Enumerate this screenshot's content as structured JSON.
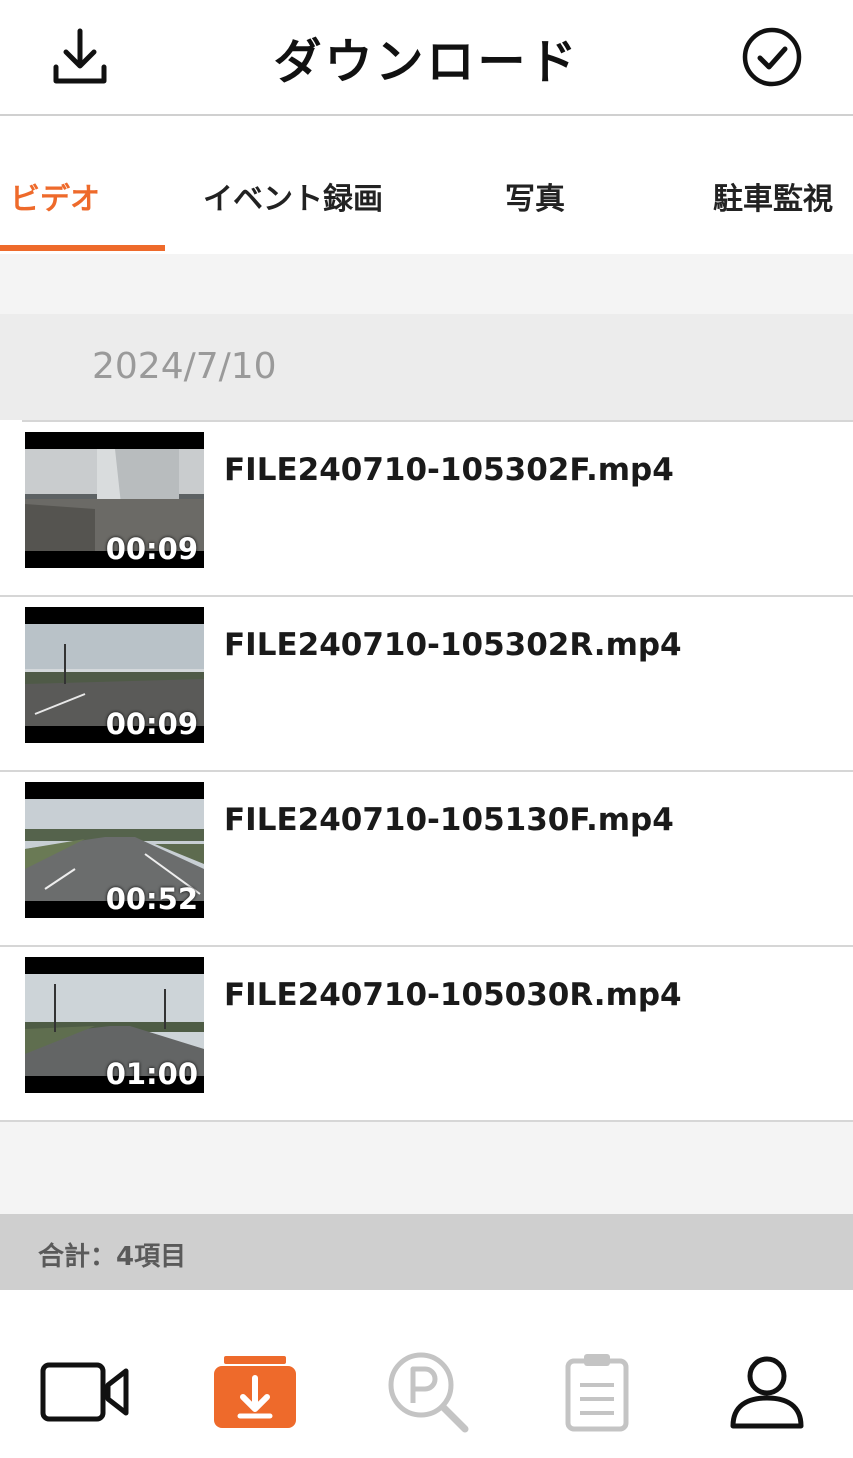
{
  "header": {
    "title": "ダウンロード",
    "left_icon": "download-icon",
    "right_icon": "check-circle-icon"
  },
  "tabs": [
    {
      "label": "ビデオ",
      "active": true
    },
    {
      "label": "イベント録画",
      "active": false
    },
    {
      "label": "写真",
      "active": false
    },
    {
      "label": "駐車監視",
      "active": false
    }
  ],
  "list": {
    "date": "2024/7/10",
    "items": [
      {
        "name": "FILE240710-105302F.mp4",
        "duration": "00:09"
      },
      {
        "name": "FILE240710-105302R.mp4",
        "duration": "00:09"
      },
      {
        "name": "FILE240710-105130F.mp4",
        "duration": "00:52"
      },
      {
        "name": "FILE240710-105030R.mp4",
        "duration": "01:00"
      }
    ]
  },
  "footer": {
    "total": "合計：4項目"
  },
  "nav": [
    {
      "icon": "video-camera-icon",
      "active": false
    },
    {
      "icon": "download-box-icon",
      "active": true
    },
    {
      "icon": "parking-search-icon",
      "active": false
    },
    {
      "icon": "clipboard-icon",
      "active": false
    },
    {
      "icon": "user-icon",
      "active": false
    }
  ],
  "colors": {
    "accent": "#ee6a2b",
    "separator": "#d6d6d6",
    "date_text": "#9a9a9a"
  }
}
